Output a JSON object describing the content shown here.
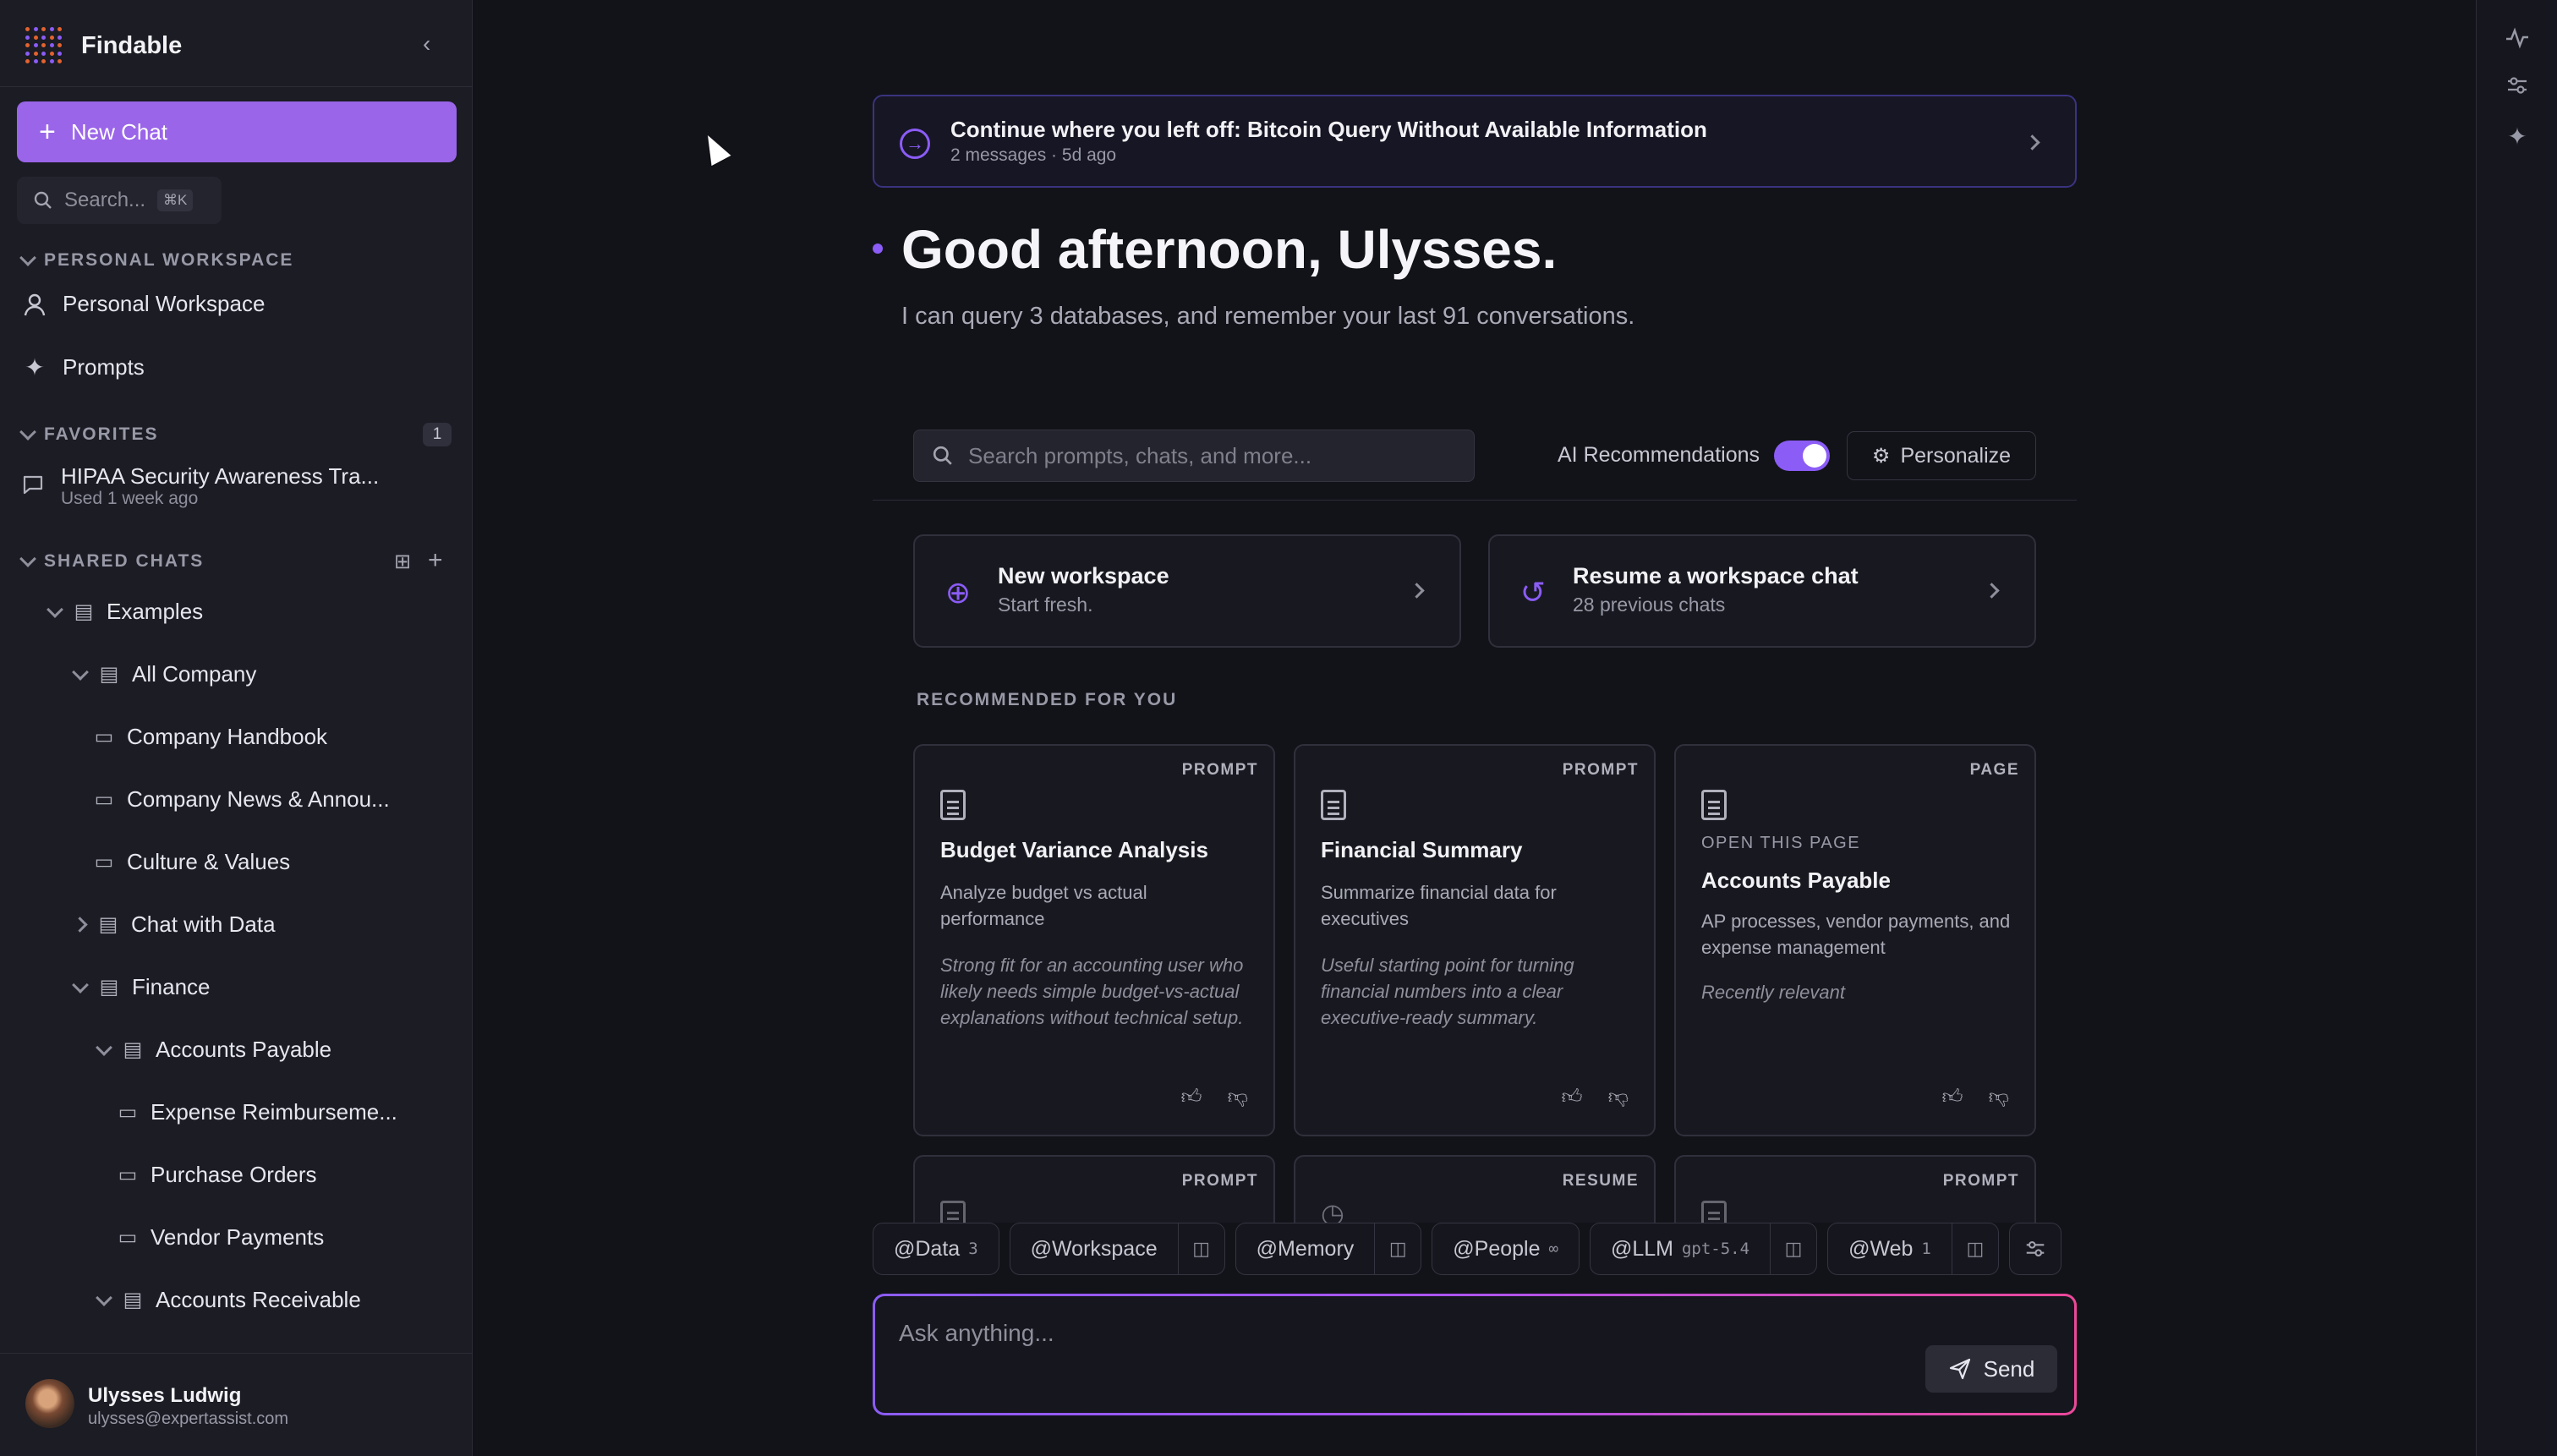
{
  "app": {
    "title": "Findable"
  },
  "sidebar": {
    "new_chat_label": "New Chat",
    "search": {
      "placeholder": "Search...",
      "shortcut": "⌘K"
    },
    "personal_section_label": "PERSONAL WORKSPACE",
    "personal_items": [
      {
        "label": "Personal Workspace",
        "icon": "user-icon"
      },
      {
        "label": "Prompts",
        "icon": "sparkle-icon"
      }
    ],
    "favorites_label": "FAVORITES",
    "favorites_count": "1",
    "favorites": [
      {
        "title": "HIPAA Security Awareness Tra...",
        "subtitle": "Used 1 week ago"
      }
    ],
    "shared_label": "SHARED CHATS",
    "tree": [
      {
        "label": "Examples",
        "type": "folder",
        "expanded": true
      },
      {
        "label": "All Company",
        "type": "folder",
        "expanded": true
      },
      {
        "label": "Company Handbook",
        "type": "chat"
      },
      {
        "label": "Company News & Annou...",
        "type": "chat"
      },
      {
        "label": "Culture & Values",
        "type": "chat"
      },
      {
        "label": "Chat with Data",
        "type": "folder",
        "expanded": false
      },
      {
        "label": "Finance",
        "type": "folder",
        "expanded": true
      },
      {
        "label": "Accounts Payable",
        "type": "folder",
        "expanded": true
      },
      {
        "label": "Expense Reimburseme...",
        "type": "chat"
      },
      {
        "label": "Purchase Orders",
        "type": "chat"
      },
      {
        "label": "Vendor Payments",
        "type": "chat"
      },
      {
        "label": "Accounts Receivable",
        "type": "folder",
        "expanded": true
      }
    ],
    "user": {
      "name": "Ulysses Ludwig",
      "email": "ulysses@expertassist.com"
    }
  },
  "main": {
    "resume_banner": {
      "title": "Continue where you left off: Bitcoin Query Without Available Information",
      "subtitle": "2 messages · 5d ago"
    },
    "greeting": "Good afternoon, Ulysses.",
    "greeting_sub": "I can query 3 databases, and remember your last 91 conversations.",
    "search_placeholder": "Search prompts, chats, and more...",
    "ai_recommendations_label": "AI Recommendations",
    "ai_recommendations_on": true,
    "personalize_label": "Personalize",
    "quick_actions": [
      {
        "title": "New workspace",
        "subtitle": "Start fresh.",
        "icon": "plus-circle-icon"
      },
      {
        "title": "Resume a workspace chat",
        "subtitle": "28 previous chats",
        "icon": "history-icon"
      }
    ],
    "recommended_label": "RECOMMENDED FOR YOU",
    "cards": [
      {
        "type": "PROMPT",
        "title": "Budget Variance Analysis",
        "description": "Analyze budget vs actual performance",
        "note": "Strong fit for an accounting user who likely needs simple budget-vs-actual explanations without technical setup."
      },
      {
        "type": "PROMPT",
        "title": "Financial Summary",
        "description": "Summarize financial data for executives",
        "note": "Useful starting point for turning financial numbers into a clear executive-ready summary."
      },
      {
        "type": "PAGE",
        "eyebrow": "OPEN THIS PAGE",
        "title": "Accounts Payable",
        "description": "AP processes, vendor payments, and expense management",
        "note": "Recently relevant"
      }
    ],
    "next_row_types": [
      "PROMPT",
      "RESUME",
      "PROMPT"
    ],
    "context_chips": [
      {
        "label": "@Data",
        "sub": "3"
      },
      {
        "label": "@Workspace",
        "sub": ""
      },
      {
        "label": "@Memory",
        "sub": ""
      },
      {
        "label": "@People",
        "sub": "∞"
      },
      {
        "label": "@LLM",
        "sub": "gpt-5.4"
      },
      {
        "label": "@Web",
        "sub": "1"
      }
    ],
    "composer": {
      "placeholder": "Ask anything...",
      "send_label": "Send"
    }
  },
  "colors": {
    "accent": "#8b5cf6",
    "new_chat": "#9a65e8",
    "background": "#121319",
    "sidebar": "#1b1c24"
  }
}
